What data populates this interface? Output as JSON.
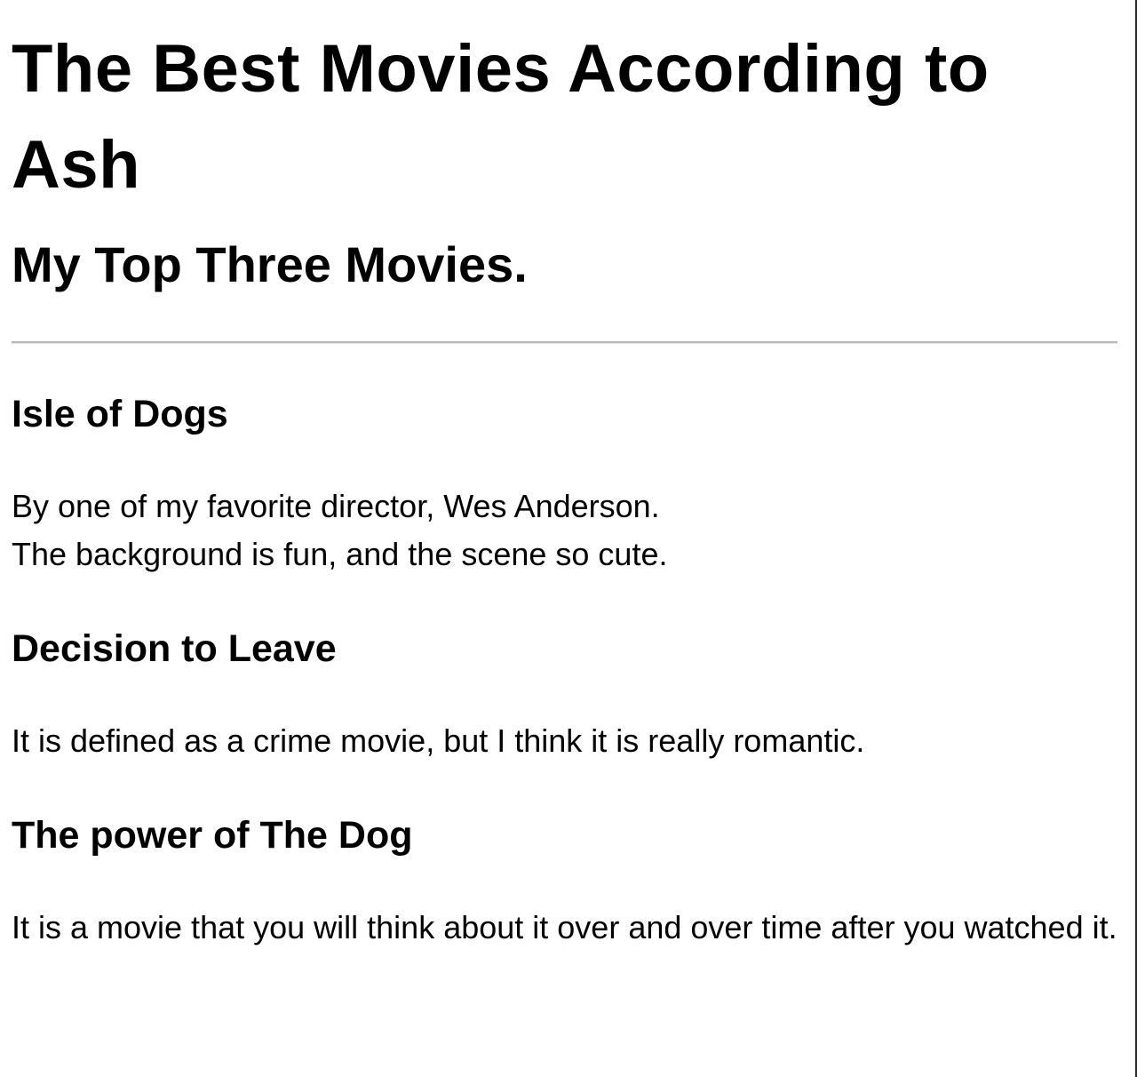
{
  "page": {
    "title": "The Best Movies According to Ash",
    "subtitle": "My Top Three Movies."
  },
  "movies": [
    {
      "title": "Isle of Dogs",
      "lines": [
        "By one of my favorite director, Wes Anderson.",
        "The background is fun, and the scene so cute."
      ]
    },
    {
      "title": "Decision to Leave",
      "lines": [
        "It is defined as a crime movie, but I think it is really romantic."
      ]
    },
    {
      "title": "The power of The Dog",
      "lines": [
        "It is a movie that you will think about it over and over time after you watched it."
      ]
    }
  ]
}
